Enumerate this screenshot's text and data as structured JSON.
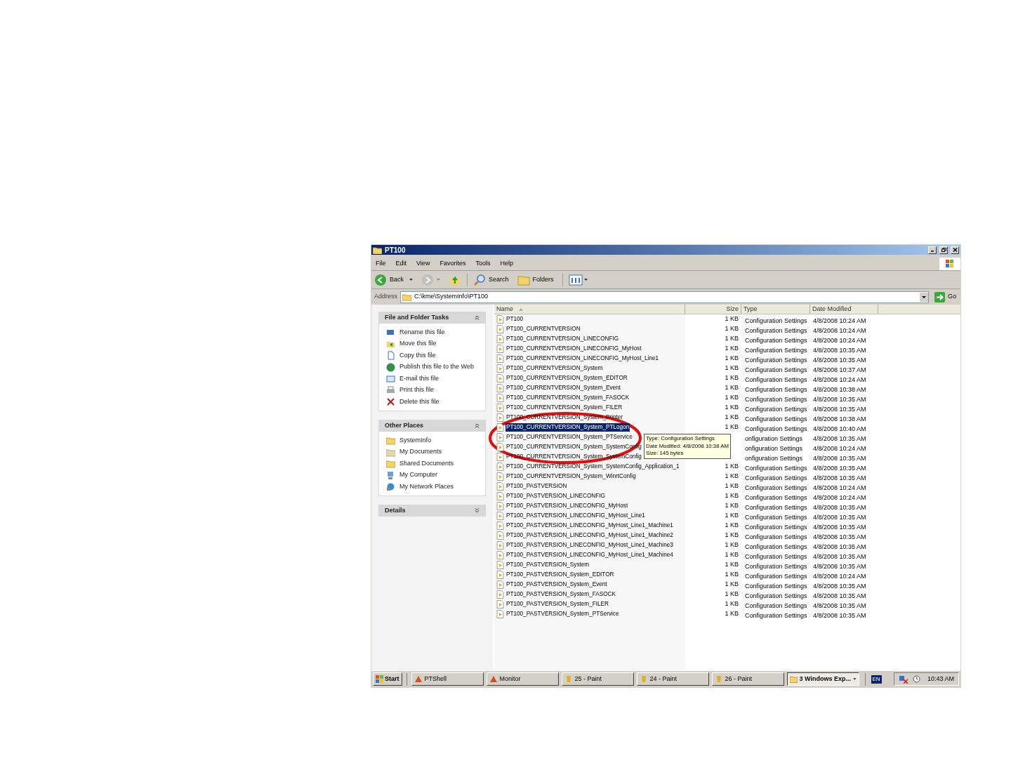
{
  "window": {
    "title": "PT100"
  },
  "menu": [
    "File",
    "Edit",
    "View",
    "Favorites",
    "Tools",
    "Help"
  ],
  "toolbar": {
    "back": "Back",
    "search": "Search",
    "folders": "Folders"
  },
  "address": {
    "label": "Address",
    "value": "C:\\kme\\SystemInfo\\PT100",
    "go": "Go"
  },
  "panels": [
    {
      "title": "File and Folder Tasks",
      "expanded": true,
      "items": [
        "Rename this file",
        "Move this file",
        "Copy this file",
        "Publish this file to the Web",
        "E-mail this file",
        "Print this file",
        "Delete this file"
      ]
    },
    {
      "title": "Other Places",
      "expanded": true,
      "items": [
        "SystemInfo",
        "My Documents",
        "Shared Documents",
        "My Computer",
        "My Network Places"
      ]
    },
    {
      "title": "Details",
      "expanded": false
    }
  ],
  "columns": [
    {
      "label": "Name",
      "sorted": true
    },
    {
      "label": "Size",
      "sorted": false
    },
    {
      "label": "Type",
      "sorted": false
    },
    {
      "label": "Date Modified",
      "sorted": false
    }
  ],
  "rows": [
    {
      "name": "PT100",
      "size": "1 KB",
      "type": "Configuration Settings",
      "date": "4/8/2008 10:24 AM",
      "selected": false
    },
    {
      "name": "PT100_CURRENTVERSION",
      "size": "1 KB",
      "type": "Configuration Settings",
      "date": "4/8/2008 10:24 AM",
      "selected": false
    },
    {
      "name": "PT100_CURRENTVERSION_LINECONFIG",
      "size": "1 KB",
      "type": "Configuration Settings",
      "date": "4/8/2008 10:24 AM",
      "selected": false
    },
    {
      "name": "PT100_CURRENTVERSION_LINECONFIG_MyHost",
      "size": "1 KB",
      "type": "Configuration Settings",
      "date": "4/8/2008 10:35 AM",
      "selected": false
    },
    {
      "name": "PT100_CURRENTVERSION_LINECONFIG_MyHost_Line1",
      "size": "1 KB",
      "type": "Configuration Settings",
      "date": "4/8/2008 10:35 AM",
      "selected": false
    },
    {
      "name": "PT100_CURRENTVERSION_System",
      "size": "1 KB",
      "type": "Configuration Settings",
      "date": "4/8/2008 10:37 AM",
      "selected": false
    },
    {
      "name": "PT100_CURRENTVERSION_System_EDITOR",
      "size": "1 KB",
      "type": "Configuration Settings",
      "date": "4/8/2008 10:24 AM",
      "selected": false
    },
    {
      "name": "PT100_CURRENTVERSION_System_Event",
      "size": "1 KB",
      "type": "Configuration Settings",
      "date": "4/8/2008 10:38 AM",
      "selected": false
    },
    {
      "name": "PT100_CURRENTVERSION_System_FASOCK",
      "size": "1 KB",
      "type": "Configuration Settings",
      "date": "4/8/2008 10:35 AM",
      "selected": false
    },
    {
      "name": "PT100_CURRENTVERSION_System_FILER",
      "size": "1 KB",
      "type": "Configuration Settings",
      "date": "4/8/2008 10:35 AM",
      "selected": false
    },
    {
      "name": "PT100_CURRENTVERSION_System_Printer",
      "size": "1 KB",
      "type": "Configuration Settings",
      "date": "4/8/2008 10:38 AM",
      "selected": false
    },
    {
      "name": "PT100_CURRENTVERSION_System_PTLogon",
      "size": "1 KB",
      "type": "Configuration Settings",
      "date": "4/8/2008 10:40 AM",
      "selected": true
    },
    {
      "name": "PT100_CURRENTVERSION_System_PTService",
      "type": "onfiguration Settings",
      "date": "4/8/2008 10:35 AM",
      "selected": false
    },
    {
      "name": "PT100_CURRENTVERSION_System_SystemConfig",
      "type": "onfiguration Settings",
      "date": "4/8/2008 10:24 AM",
      "selected": false
    },
    {
      "name": "PT100_CURRENTVERSION_System_SystemConfig",
      "type": "onfiguration Settings",
      "date": "4/8/2008 10:35 AM",
      "selected": false
    },
    {
      "name": "PT100_CURRENTVERSION_System_SystemConfig_Application_1",
      "size": "1 KB",
      "type": "Configuration Settings",
      "date": "4/8/2008 10:35 AM",
      "selected": false
    },
    {
      "name": "PT100_CURRENTVERSION_System_WinrtConfig",
      "size": "1 KB",
      "type": "Configuration Settings",
      "date": "4/8/2008 10:35 AM",
      "selected": false
    },
    {
      "name": "PT100_PASTVERSION",
      "size": "1 KB",
      "type": "Configuration Settings",
      "date": "4/8/2008 10:24 AM",
      "selected": false
    },
    {
      "name": "PT100_PASTVERSION_LINECONFIG",
      "size": "1 KB",
      "type": "Configuration Settings",
      "date": "4/8/2008 10:24 AM",
      "selected": false
    },
    {
      "name": "PT100_PASTVERSION_LINECONFIG_MyHost",
      "size": "1 KB",
      "type": "Configuration Settings",
      "date": "4/8/2008 10:35 AM",
      "selected": false
    },
    {
      "name": "PT100_PASTVERSION_LINECONFIG_MyHost_Line1",
      "size": "1 KB",
      "type": "Configuration Settings",
      "date": "4/8/2008 10:35 AM",
      "selected": false
    },
    {
      "name": "PT100_PASTVERSION_LINECONFIG_MyHost_Line1_Machine1",
      "size": "1 KB",
      "type": "Configuration Settings",
      "date": "4/8/2008 10:35 AM",
      "selected": false
    },
    {
      "name": "PT100_PASTVERSION_LINECONFIG_MyHost_Line1_Machine2",
      "size": "1 KB",
      "type": "Configuration Settings",
      "date": "4/8/2008 10:35 AM",
      "selected": false
    },
    {
      "name": "PT100_PASTVERSION_LINECONFIG_MyHost_Line1_Machine3",
      "size": "1 KB",
      "type": "Configuration Settings",
      "date": "4/8/2008 10:35 AM",
      "selected": false
    },
    {
      "name": "PT100_PASTVERSION_LINECONFIG_MyHost_Line1_Machine4",
      "size": "1 KB",
      "type": "Configuration Settings",
      "date": "4/8/2008 10:35 AM",
      "selected": false
    },
    {
      "name": "PT100_PASTVERSION_System",
      "size": "1 KB",
      "type": "Configuration Settings",
      "date": "4/8/2008 10:35 AM",
      "selected": false
    },
    {
      "name": "PT100_PASTVERSION_System_EDITOR",
      "size": "1 KB",
      "type": "Configuration Settings",
      "date": "4/8/2008 10:24 AM",
      "selected": false
    },
    {
      "name": "PT100_PASTVERSION_System_Event",
      "size": "1 KB",
      "type": "Configuration Settings",
      "date": "4/8/2008 10:35 AM",
      "selected": false
    },
    {
      "name": "PT100_PASTVERSION_System_FASOCK",
      "size": "1 KB",
      "type": "Configuration Settings",
      "date": "4/8/2008 10:35 AM",
      "selected": false
    },
    {
      "name": "PT100_PASTVERSION_System_FILER",
      "size": "1 KB",
      "type": "Configuration Settings",
      "date": "4/8/2008 10:35 AM",
      "selected": false
    },
    {
      "name": "PT100_PASTVERSION_System_PTService",
      "size": "1 KB",
      "type": "Configuration Settings",
      "date": "4/8/2008 10:35 AM",
      "selected": false
    }
  ],
  "tooltip": [
    "Type: Configuration Settings",
    "Date Modified: 4/8/2008 10:38 AM",
    "Size: 145 bytes"
  ],
  "taskbar": {
    "start": "Start",
    "buttons": [
      {
        "label": "PTShell",
        "selected": false
      },
      {
        "label": "Monitor",
        "selected": false
      },
      {
        "label": "25 - Paint",
        "selected": false
      },
      {
        "label": "24 - Paint",
        "selected": false
      },
      {
        "label": "26 - Paint",
        "selected": false
      },
      {
        "label": "3 Windows Exp...",
        "selected": true
      }
    ],
    "language": "EN",
    "clock": "10:43 AM"
  }
}
